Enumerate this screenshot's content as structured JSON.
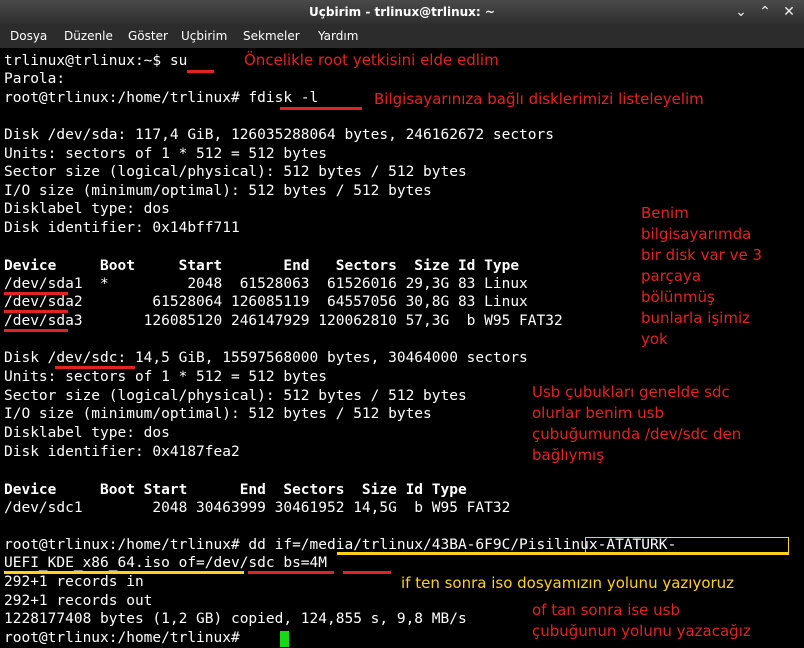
{
  "window": {
    "title": "Uçbirim - trlinux@trlinux: ~",
    "minimize_glyph": "⌄",
    "maximize_glyph": "⌃",
    "close_glyph": "✕"
  },
  "menu": [
    "Dosya",
    "Düzenle",
    "Göster",
    "Uçbirim",
    "Sekmeler",
    "Yardım"
  ],
  "terminal": {
    "lines": [
      "trlinux@trlinux:~$ su",
      "Parola:",
      "root@trlinux:/home/trlinux# fdisk -l",
      "",
      "Disk /dev/sda: 117,4 GiB, 126035288064 bytes, 246162672 sectors",
      "Units: sectors of 1 * 512 = 512 bytes",
      "Sector size (logical/physical): 512 bytes / 512 bytes",
      "I/O size (minimum/optimal): 512 bytes / 512 bytes",
      "Disklabel type: dos",
      "Disk identifier: 0x14bff711",
      "",
      "Device     Boot     Start       End   Sectors  Size Id Type",
      "/dev/sda1  *         2048  61528063  61526016 29,3G 83 Linux",
      "/dev/sda2        61528064 126085119  64557056 30,8G 83 Linux",
      "/dev/sda3       126085120 246147929 120062810 57,3G  b W95 FAT32",
      "",
      "Disk /dev/sdc: 14,5 GiB, 15597568000 bytes, 30464000 sectors",
      "Units: sectors of 1 * 512 = 512 bytes",
      "Sector size (logical/physical): 512 bytes / 512 bytes",
      "I/O size (minimum/optimal): 512 bytes / 512 bytes",
      "Disklabel type: dos",
      "Disk identifier: 0x4187fea2",
      "",
      "Device     Boot Start      End  Sectors  Size Id Type",
      "/dev/sdc1        2048 30463999 30461952 14,5G  b W95 FAT32",
      "",
      "root@trlinux:/home/trlinux# dd if=/media/trlinux/43BA-6F9C/Pisilinux-ATATURK-",
      "UEFI_KDE_x86_64.iso of=/dev/sdc bs=4M",
      "292+1 records in",
      "292+1 records out",
      "1228177408 bytes (1,2 GB) copied, 124,855 s, 9,8 MB/s",
      "root@trlinux:/home/trlinux# "
    ]
  },
  "annotations": {
    "root": "Öncelikle root yetkisini elde edlim",
    "list_disks": "Bilgisayarınıza bağlı disklerimizi listeleyelim",
    "my_disk": "Benim\nbilgisayarımda\nbir disk var ve 3\nparçaya\nbölünmüş\nbunlarla işimiz\nyok",
    "usb": "Usb çubukları genelde sdc\nolurlar benim usb\nçubuğumunda /dev/sdc den\nbağlıymış",
    "if_path": "if ten sonra iso dosyamızın yolunu yazıyoruz",
    "of_path": "of tan sonra ise usb\nçubuğunun yolunu yazacağız"
  },
  "colors": {
    "annotation_red": "#e32323",
    "annotation_yellow": "#ffd21a",
    "cursor": "#18d818"
  }
}
